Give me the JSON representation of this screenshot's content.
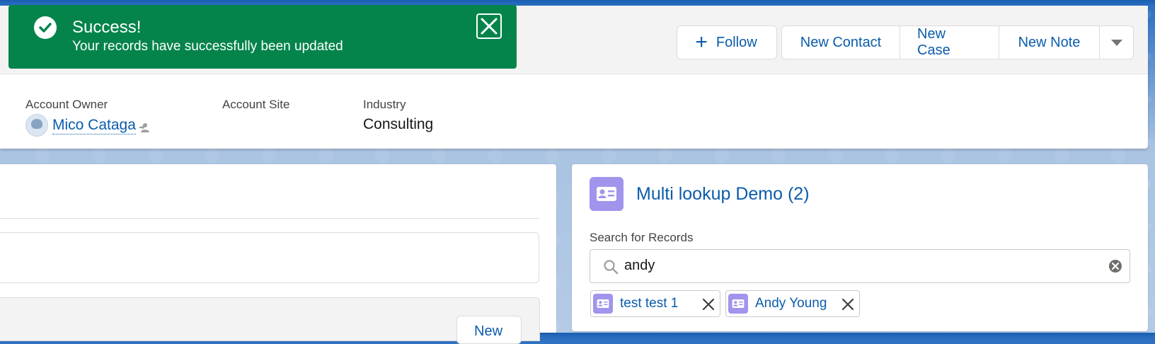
{
  "toast": {
    "title": "Success!",
    "message": "Your records have successfully been updated"
  },
  "header": {
    "actions": {
      "follow": "Follow",
      "new_contact": "New Contact",
      "new_case": "New Case",
      "new_note": "New Note"
    },
    "fields": [
      {
        "label": "Account Owner",
        "value": "Mico Cataga"
      },
      {
        "label": "Account Site",
        "value": ""
      },
      {
        "label": "Industry",
        "value": "Consulting"
      }
    ]
  },
  "main": {
    "new_button": "New"
  },
  "multi_lookup": {
    "title": "Multi lookup Demo (2)",
    "search_label": "Search for Records",
    "search_value": "andy",
    "selected": [
      {
        "label": "test test 1"
      },
      {
        "label": "Andy Young"
      }
    ]
  },
  "colors": {
    "success": "#04844b",
    "link": "#0b5cab",
    "record_icon": "#a094ed"
  },
  "icons": [
    "check-icon",
    "close-icon",
    "plus-icon",
    "chevron-down-icon",
    "avatar",
    "change-owner-icon",
    "contact-card-icon",
    "search-icon",
    "clear-icon",
    "remove-icon"
  ]
}
